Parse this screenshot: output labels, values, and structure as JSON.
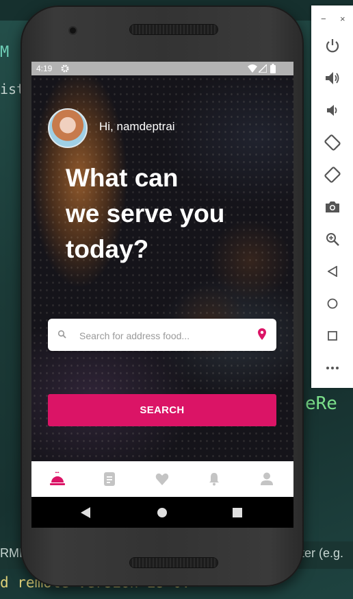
{
  "status_bar": {
    "time": "4:19"
  },
  "greeting": "Hi, namdeptrai",
  "headline": {
    "line1": "What can",
    "line2": "we serve you",
    "line3": "today?"
  },
  "search": {
    "placeholder": "Search for address food..."
  },
  "search_button": {
    "label": "SEARCH"
  },
  "bottom_nav": {
    "items": [
      "home-dish-icon",
      "orders-icon",
      "favorites-icon",
      "notifications-icon",
      "profile-icon"
    ],
    "active": "home-dish-icon"
  },
  "colors": {
    "accent": "#db1466",
    "inactive": "#c4c4c4"
  },
  "ide": {
    "left_top": "M",
    "left_line": "istF",
    "right_frag": "eRe",
    "bottom_left": "RMI",
    "bottom_right": "ter (e.g.",
    "last_line": "d remote version is 0."
  },
  "emulator_toolbar": {
    "window_controls": {
      "minimize": "−",
      "close": "×"
    },
    "buttons": [
      "power-icon",
      "volume-up-icon",
      "volume-down-icon",
      "rotate-left-icon",
      "rotate-right-icon",
      "camera-icon",
      "zoom-icon",
      "back-icon",
      "home-icon",
      "overview-icon",
      "more-icon"
    ]
  }
}
